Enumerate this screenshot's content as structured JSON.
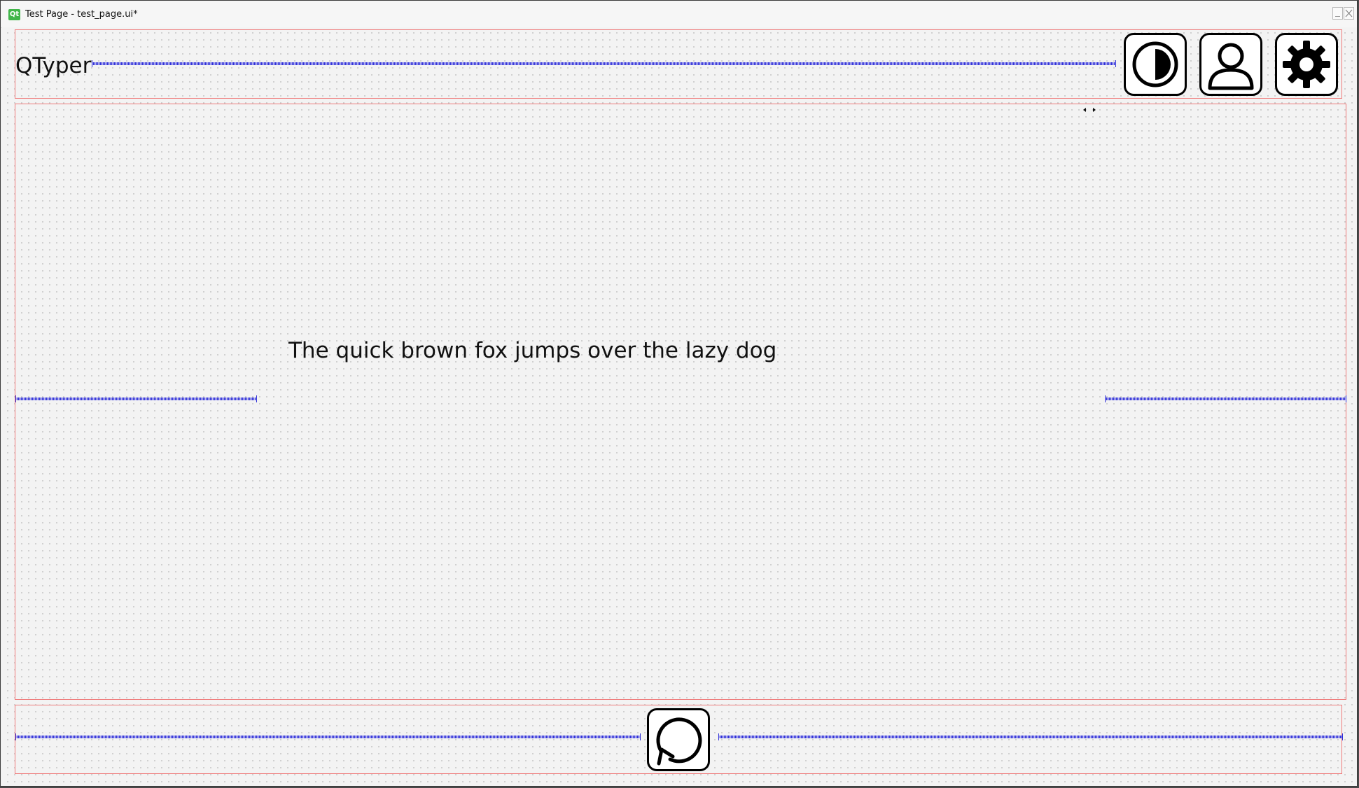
{
  "window": {
    "title": "Test Page - test_page.ui*",
    "logo_text": "Qt"
  },
  "header": {
    "app_title": "QTyper",
    "buttons": [
      {
        "icon": "contrast-icon"
      },
      {
        "icon": "user-icon"
      },
      {
        "icon": "gear-icon"
      }
    ]
  },
  "main": {
    "sample_text": "The quick brown fox jumps over the lazy dog"
  },
  "footer": {
    "buttons": [
      {
        "icon": "restart-icon"
      }
    ]
  },
  "colors": {
    "layout_border": "#ef7a7a",
    "spacer": "#2f2fd8",
    "button_border": "#000000",
    "qt_green": "#41b64a"
  }
}
